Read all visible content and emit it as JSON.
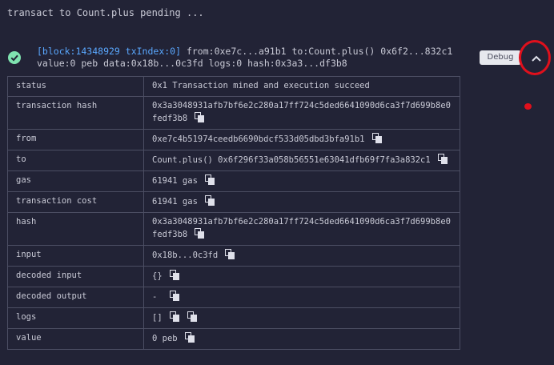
{
  "status_line": "transact to Count.plus pending ...",
  "summary": {
    "block_part": "[block:14348929 txIndex:0]",
    "line1_rest": "from:0xe7c...a91b1 to:Count.plus() 0x6f2...832c1",
    "line2": "value:0 peb data:0x18b...0c3fd logs:0 hash:0x3a3...df3b8"
  },
  "debug_label": "Debug",
  "icons": [
    "check-circle-icon",
    "chevron-up-icon",
    "copy-icon"
  ],
  "colors": {
    "accent_blue": "#5aa8ff",
    "success": "#7fe3b0",
    "highlight": "#e0101c"
  },
  "rows": [
    {
      "key": "status",
      "value": "0x1 Transaction mined and execution succeed"
    },
    {
      "key": "transaction hash",
      "value": "0x3a3048931afb7bf6e2c280a17ff724c5ded6641090d6ca3f7d699b8e0fedf3b8"
    },
    {
      "key": "from",
      "value": "0xe7c4b51974ceedb6690bdcf533d05dbd3bfa91b1"
    },
    {
      "key": "to",
      "value": "Count.plus() 0x6f296f33a058b56551e63041dfb69f7fa3a832c1"
    },
    {
      "key": "gas",
      "value": "61941 gas"
    },
    {
      "key": "transaction cost",
      "value": "61941 gas"
    },
    {
      "key": "hash",
      "value": "0x3a3048931afb7bf6e2c280a17ff724c5ded6641090d6ca3f7d699b8e0fedf3b8"
    },
    {
      "key": "input",
      "value": "0x18b...0c3fd"
    },
    {
      "key": "decoded input",
      "value": "{}"
    },
    {
      "key": "decoded output",
      "value": " - "
    },
    {
      "key": "logs",
      "value": "[]"
    },
    {
      "key": "value",
      "value": "0 peb"
    }
  ]
}
